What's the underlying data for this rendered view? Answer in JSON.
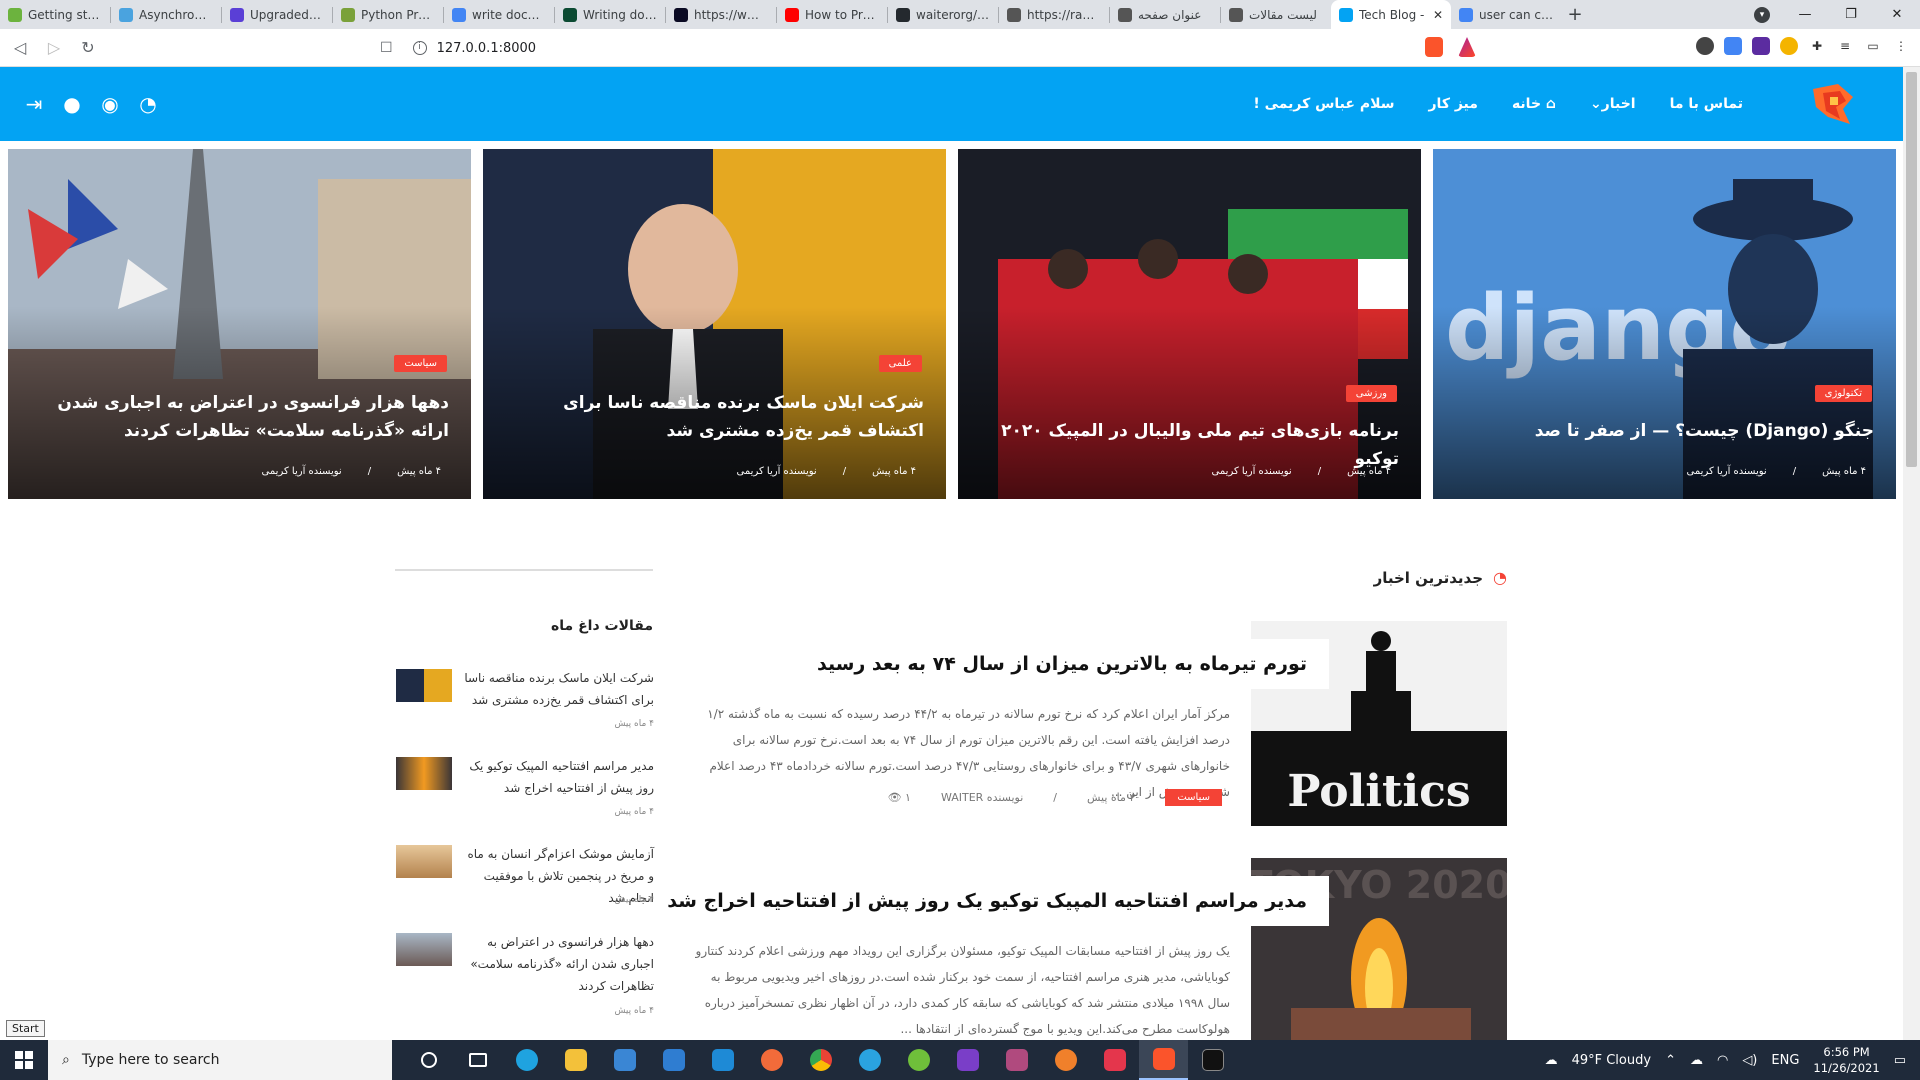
{
  "browser": {
    "tabs": [
      {
        "title": "Getting started",
        "color": "#6cb33e"
      },
      {
        "title": "Asynchronous T",
        "color": "#4aa3df"
      },
      {
        "title": "Upgraded - Wa",
        "color": "#5a3fd6"
      },
      {
        "title": "Python Progran",
        "color": "#7aa13a"
      },
      {
        "title": "write documen",
        "color": "#4285f4"
      },
      {
        "title": "Writing docum",
        "color": "#0c4b33"
      },
      {
        "title": "https://www.fre",
        "color": "#0a0a23"
      },
      {
        "title": "How to Present",
        "color": "#ff0000"
      },
      {
        "title": "waiterorg/Waite",
        "color": "#24292e"
      },
      {
        "title": "https://raw.githu",
        "color": "#555555"
      },
      {
        "title": "عنوان صفحه",
        "color": "#555555"
      },
      {
        "title": "لیست مقالات",
        "color": "#555555"
      },
      {
        "title": "Tech Blog -",
        "color": "#03a3f3",
        "active": true
      },
      {
        "title": "user can comm",
        "color": "#4285f4"
      }
    ],
    "url": "127.0.0.1:8000"
  },
  "header": {
    "greeting": "سلام عباس کریمی !",
    "menu": [
      "میز کار",
      "خانه",
      "اخبار",
      "تماس با ما"
    ],
    "home_icon": "home-icon",
    "news_dropdown_icon": "chevron-down-icon",
    "icons": [
      "logout-icon",
      "apple-icon",
      "android-icon",
      "rss-icon"
    ]
  },
  "hero": [
    {
      "category": "تکنولوژی",
      "title": "جنگو (Django) چیست؟ — از صفر تا صد",
      "time": "۴ ماه پیش",
      "author": "نویسنده آریا کریمی"
    },
    {
      "category": "ورزشی",
      "title": "برنامه بازی‌های تیم ملی والیبال در المپیک ۲۰۲۰ توکیو",
      "time": "۴ ماه پیش",
      "author": "نویسنده آریا کریمی"
    },
    {
      "category": "علمی",
      "title": "شرکت ایلان ماسک برنده مناقصه ناسا برای اکتشاف قمر یخ‌زده مشتری شد",
      "time": "۴ ماه پیش",
      "author": "نویسنده آریا کریمی"
    },
    {
      "category": "سیاست",
      "title": "دهها هزار فرانسوی در اعتراض به اجباری شدن ارائه «گذرنامه سلامت» تظاهرات کردند",
      "time": "۴ ماه پیش",
      "author": "نویسنده آریا کریمی"
    }
  ],
  "latest": {
    "heading": "جدیدترین اخبار",
    "posts": [
      {
        "title": "تورم تیرماه به بالاترین میزان از سال ۷۴ به بعد رسید",
        "thumb_text": "Politics",
        "excerpt": "مرکز آمار ایران اعلام کرد که نرخ تورم سالانه در تیرماه به ۴۴/۲ درصد رسیده که نسبت به ماه گذشته ۱/۲ درصد افزایش یافته است. این رقم بالاترین میزان تورم از سال ۷۴ به بعد است.نرخ تورم سالانه برای خانوارهای شهری ۴۳/۷ و برای خانوارهای روستایی ۴۷/۳ درصد است.تورم سالانه خردادماه ۴۳ درصد اعلام شده بود. پیش از این ...",
        "category": "سیاست",
        "time": "۴ ماه پیش",
        "author": "نویسنده WAITER",
        "views": "۱"
      },
      {
        "title": "مدیر مراسم افتتاحیه المپیک توکیو یک روز پیش از افتتاحیه اخراج شد",
        "thumb_text": "TOKYO 2020",
        "excerpt": "یک روز پیش از افتتاحیه مسابقات المپیک توکیو، مسئولان برگزاری این رویداد مهم ورزشی اعلام کردند کنتارو کوبایاشی، مدیر هنری مراسم افتتاحیه، از سمت خود برکنار شده است.در روزهای اخیر ویدیویی مربوط به سال ۱۹۹۸ میلادی منتشر شد که کوبایاشی که سابقه کار کمدی دارد، در آن اظهار نظری تمسخرآمیز درباره هولوکاست مطرح می‌کند.این ویدیو با موج گسترده‌ای از انتقادها ..."
      }
    ]
  },
  "sidebar": {
    "heading": "مقالات داغ ماه",
    "items": [
      {
        "title": "شرکت ایلان ماسک برنده مناقصه ناسا برای اکتشاف قمر یخ‌زده مشتری شد",
        "time": "۴ ماه پیش"
      },
      {
        "title": "مدیر مراسم افتتاحیه المپیک توکیو یک روز پیش از افتتاحیه اخراج شد",
        "time": "۴ ماه پیش"
      },
      {
        "title": "آزمایش موشک اعزام‌گر انسان به ماه و مریخ در پنجمین تلاش با موفقیت انجام شد",
        "time": "۴ ماه پیش"
      },
      {
        "title": "دهها هزار فرانسوی در اعتراض به اجباری شدن ارائه «گذرنامه سلامت» تظاهرات کردند",
        "time": "۴ ماه پیش"
      }
    ]
  },
  "taskbar": {
    "start_tooltip": "Start",
    "search_placeholder": "Type here to search",
    "weather": "49°F  Cloudy",
    "lang": "ENG",
    "time": "6:56 PM",
    "date": "11/26/2021"
  },
  "colors": {
    "accent": "#03a3f3",
    "badge": "#f44336"
  }
}
